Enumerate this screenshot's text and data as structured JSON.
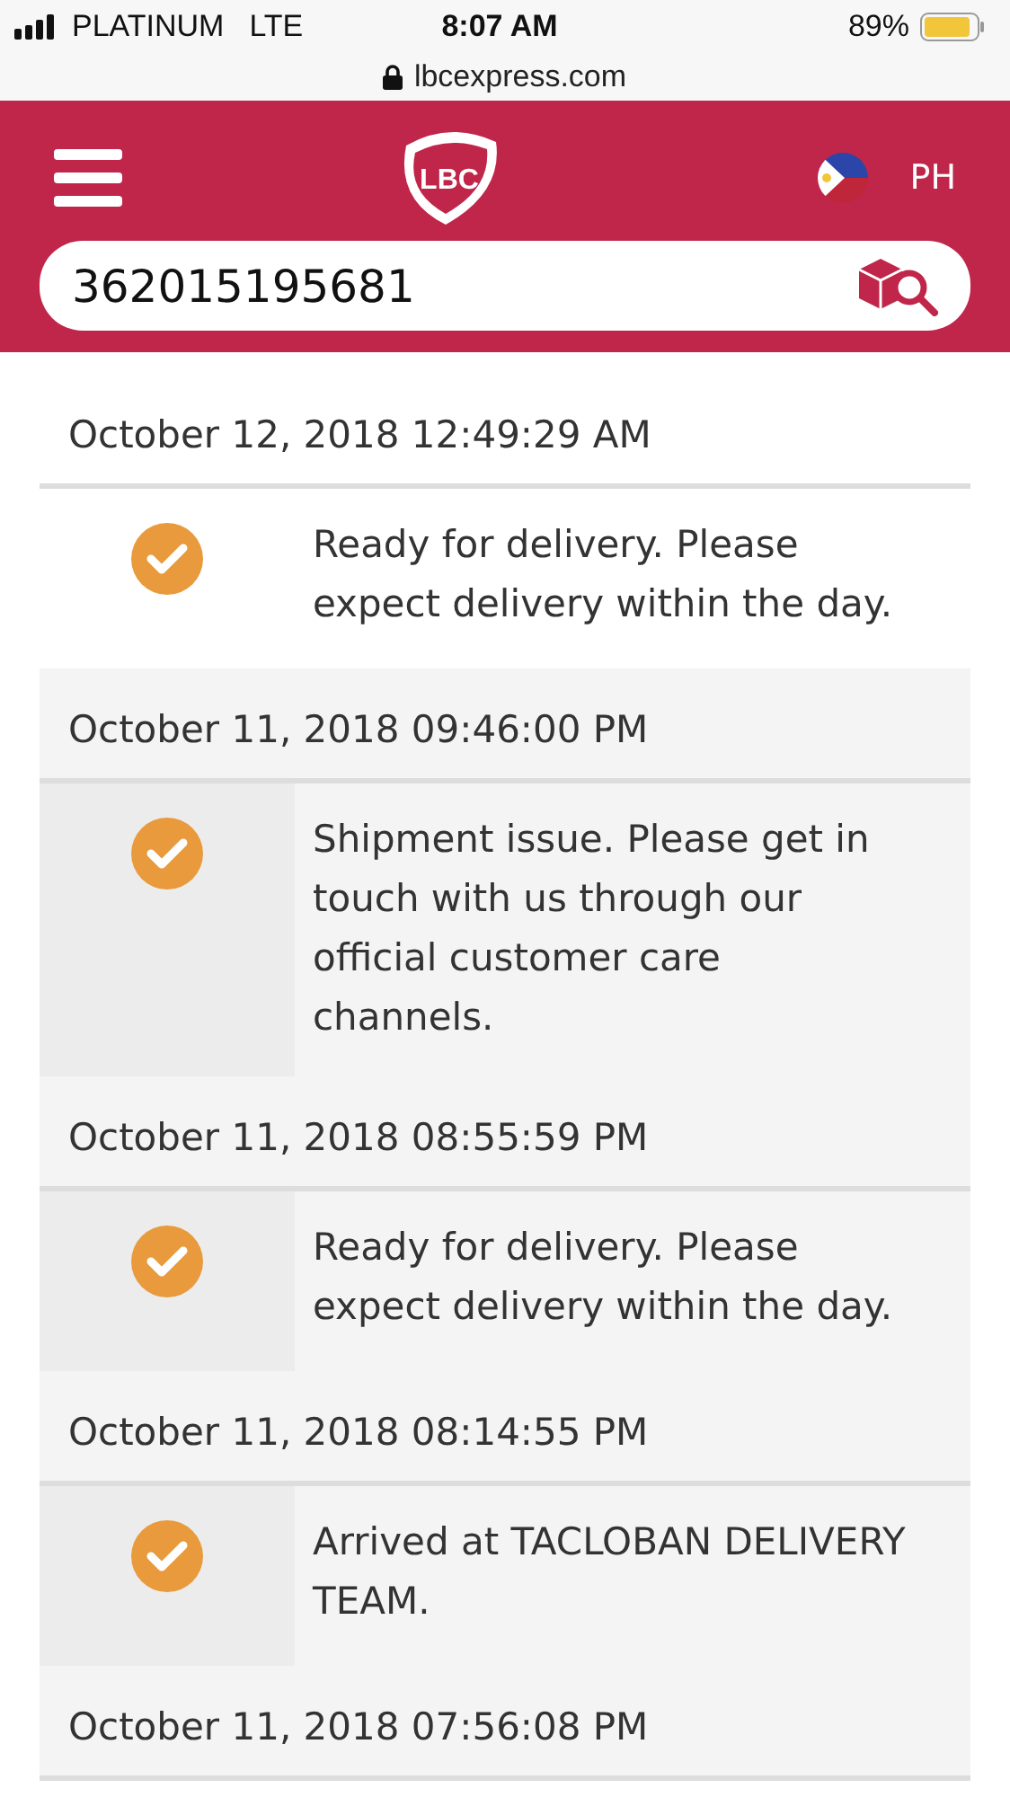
{
  "status_bar": {
    "carrier": "PLATINUM",
    "network": "LTE",
    "time": "8:07 AM",
    "battery": "89%"
  },
  "address_bar": {
    "url": "lbcexpress.com"
  },
  "header": {
    "logo": "LBC",
    "country": "PH"
  },
  "search": {
    "value": "362015195681"
  },
  "events": [
    {
      "date": "October 12, 2018 12:49:29 AM",
      "status": "Ready for delivery. Please expect delivery within the day.",
      "latest": true
    },
    {
      "date": "October 11, 2018 09:46:00 PM",
      "status": "Shipment issue. Please get in touch with us through our official customer care channels.",
      "latest": false
    },
    {
      "date": "October 11, 2018 08:55:59 PM",
      "status": "Ready for delivery. Please expect delivery within the day.",
      "latest": false
    },
    {
      "date": "October 11, 2018 08:14:55 PM",
      "status": "Arrived at TACLOBAN DELIVERY TEAM.",
      "latest": false
    },
    {
      "date": "October 11, 2018 07:56:08 PM",
      "latest": false
    }
  ]
}
